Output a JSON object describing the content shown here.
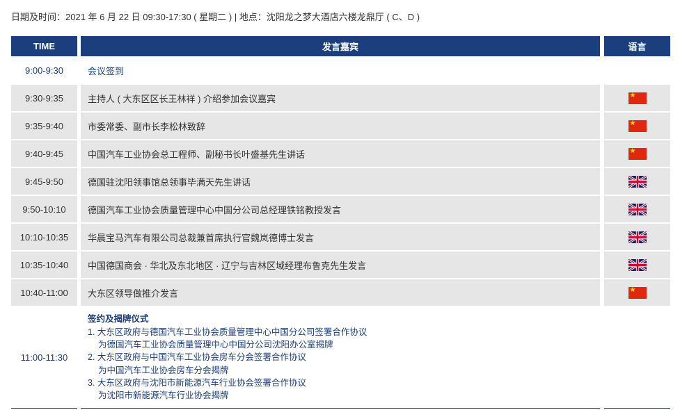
{
  "header_info": "日期及时间：2021 年 6 月 22 日 09:30-17:30 ( 星期二 ) | 地点：沈阳龙之梦大酒店六楼龙鼎厅 ( C、D )",
  "columns": {
    "time": "TIME",
    "speaker": "发言嘉宾",
    "language": "语言"
  },
  "rows": [
    {
      "time": "9:00-9:30",
      "speaker": "会议签到",
      "lang": ""
    },
    {
      "time": "9:30-9:35",
      "speaker": "主持人 ( 大东区区长王林祥 ) 介绍参加会议嘉宾",
      "lang": "cn-flag-icon"
    },
    {
      "time": "9:35-9:40",
      "speaker": "市委常委、副市长李松林致辞",
      "lang": "cn-flag-icon"
    },
    {
      "time": "9:40-9:45",
      "speaker": "中国汽车工业协会总工程师、副秘书长叶盛基先生讲话",
      "lang": "cn-flag-icon"
    },
    {
      "time": "9:45-9:50",
      "speaker": "德国驻沈阳领事馆总领事毕满天先生讲话",
      "lang": "uk-flag-icon"
    },
    {
      "time": "9:50-10:10",
      "speaker": "德国汽车工业协会质量管理中心中国分公司总经理铁铭教授发言",
      "lang": "uk-flag-icon"
    },
    {
      "time": "10:10-10:35",
      "speaker": "华晨宝马汽车有限公司总裁兼首席执行官魏岚德博士发言",
      "lang": "uk-flag-icon"
    },
    {
      "time": "10:35-10:40",
      "speaker": "中国德国商会 · 华北及东北地区 · 辽宁与吉林区域经理布鲁克先生发言",
      "lang": "uk-flag-icon"
    },
    {
      "time": "10:40-11:00",
      "speaker": "大东区领导做推介发言",
      "lang": "cn-flag-icon"
    }
  ],
  "last_row": {
    "time": "11:00-11:30",
    "title": "签约及揭牌仪式",
    "lines": [
      "1. 大东区政府与德国汽车工业协会质量管理中心中国分公司签署合作协议",
      "为德国汽车工业协会质量管理中心中国分公司沈阳办公室揭牌",
      "2. 大东区政府与中国汽车工业协会房车分会签署合作协议",
      "为中国汽车工业协会房车分会揭牌",
      "3. 大东区政府与沈阳市新能源汽车行业协会签署合作协议",
      "为沈阳市新能源汽车行业协会揭牌"
    ]
  },
  "colors": {
    "header": "#1b3f7d",
    "shade": "#e6e6e6",
    "link_text": "#1b3f7d"
  }
}
